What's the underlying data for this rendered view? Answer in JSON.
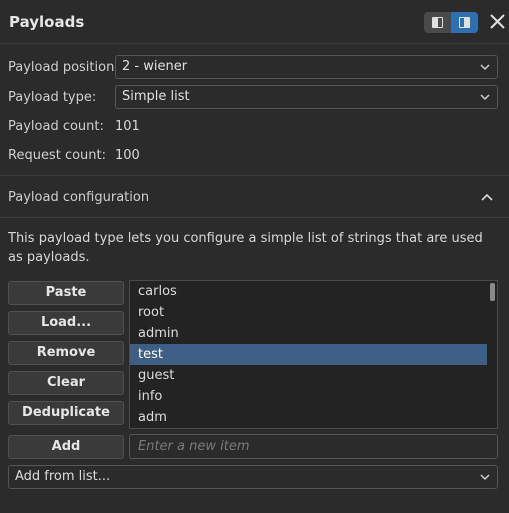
{
  "header": {
    "title": "Payloads",
    "layout_toggle": {
      "options": [
        "layout-left-icon",
        "layout-right-icon"
      ],
      "active": 1
    },
    "close_icon": "close-icon"
  },
  "settings": {
    "position_label": "Payload position:",
    "position_value": "2 - wiener",
    "type_label": "Payload type:",
    "type_value": "Simple list",
    "count_label": "Payload count:",
    "count_value": "101",
    "request_label": "Request count:",
    "request_value": "100"
  },
  "config": {
    "section_title": "Payload configuration",
    "description": "This payload type lets you configure a simple list of strings that are used as payloads.",
    "buttons": {
      "paste": "Paste",
      "load": "Load...",
      "remove": "Remove",
      "clear": "Clear",
      "deduplicate": "Deduplicate",
      "add": "Add"
    },
    "list": {
      "items": [
        "carlos",
        "root",
        "admin",
        "test",
        "guest",
        "info",
        "adm"
      ],
      "selected_index": 3
    },
    "new_item_placeholder": "Enter a new item",
    "add_from_list_label": "Add from list..."
  },
  "colors": {
    "accent": "#2f6fb0",
    "selection": "#3e5f85",
    "background": "#2b2b2b"
  }
}
